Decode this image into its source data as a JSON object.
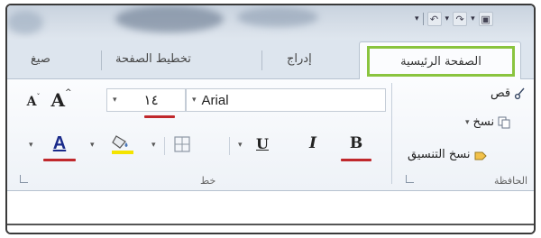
{
  "tabs": {
    "home": "الصفحة الرئيسية",
    "insert": "إدراج",
    "page_layout": "تخطيط الصفحة",
    "formulas": "صيغ"
  },
  "font_group": {
    "label": "خط",
    "font_name": "Arial",
    "font_size": "١٤",
    "bold": "B",
    "italic": "I",
    "underline": "U",
    "grow": "A",
    "shrink": "A",
    "font_color": "A"
  },
  "clipboard_group": {
    "label": "الحافظة",
    "cut": "قص",
    "copy": "نسخ",
    "format_painter": "نسخ التنسيق"
  },
  "colors": {
    "active_tab_outline": "#8ac43f",
    "annotation_underline": "#c0282c",
    "highlight_yellow": "#f4e400",
    "font_color_red": "#c0282c"
  },
  "icons": [
    "save-icon",
    "undo-icon",
    "redo-icon",
    "cut-icon",
    "copy-icon",
    "format-painter-icon",
    "fill-color-icon",
    "borders-icon",
    "dialog-launcher-icon"
  ]
}
